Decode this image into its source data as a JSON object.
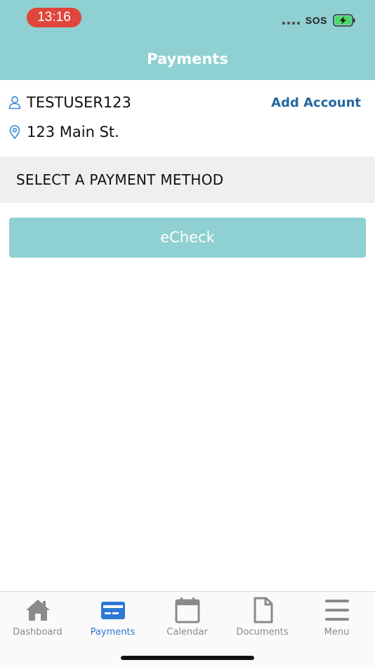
{
  "status_bar": {
    "time": "13:16",
    "carrier": "SOS"
  },
  "header": {
    "title": "Payments"
  },
  "account": {
    "username": "TESTUSER123",
    "address": "123 Main St.",
    "add_account_label": "Add Account"
  },
  "section": {
    "title": "SELECT A PAYMENT METHOD"
  },
  "payment_methods": [
    {
      "label": "eCheck"
    }
  ],
  "tabbar": {
    "active": "Payments",
    "active_color": "#2f78d6",
    "inactive_color": "#8a8a8a",
    "items": [
      {
        "label": "Dashboard",
        "icon": "home-icon"
      },
      {
        "label": "Payments",
        "icon": "credit-card-icon"
      },
      {
        "label": "Calendar",
        "icon": "calendar-icon"
      },
      {
        "label": "Documents",
        "icon": "document-icon"
      },
      {
        "label": "Menu",
        "icon": "hamburger-menu-icon"
      }
    ]
  },
  "colors": {
    "header_bg": "#8fd0d2",
    "link": "#2467a1",
    "section_bg": "#efefef"
  }
}
